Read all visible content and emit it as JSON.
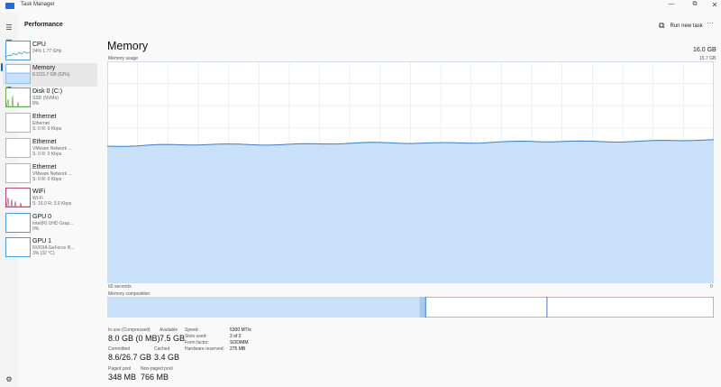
{
  "app": {
    "title": "Task Manager"
  },
  "window_controls": {
    "minimize": "—",
    "maximize": "⧉",
    "close": "✕"
  },
  "header": {
    "page_title": "Performance",
    "run_new_task": "Run new task",
    "more": "···"
  },
  "sidebar": [
    {
      "name": "CPU",
      "sub1": "24% 1.77 GHz",
      "sub2": "",
      "icon": "cpu-thumbnail",
      "color": "#4e9ad6"
    },
    {
      "name": "Memory",
      "sub1": "8.2/15.7 GB (52%)",
      "sub2": "",
      "icon": "memory-thumbnail",
      "color": "#8fbce8"
    },
    {
      "name": "Disk 0 (C:)",
      "sub1": "SSD (NVMe)",
      "sub2": "8%",
      "icon": "disk-thumbnail",
      "color": "#6aa84f"
    },
    {
      "name": "Ethernet",
      "sub1": "Ethernet",
      "sub2": "S: 0 R: 0 Kbps",
      "icon": "ethernet-thumbnail",
      "color": "#b5b5b5"
    },
    {
      "name": "Ethernet",
      "sub1": "VMware Network ...",
      "sub2": "S: 0 R: 0 Kbps",
      "icon": "ethernet-thumbnail",
      "color": "#b5b5b5"
    },
    {
      "name": "Ethernet",
      "sub1": "VMware Network ...",
      "sub2": "S: 0 R: 0 Kbps",
      "icon": "ethernet-thumbnail",
      "color": "#b5b5b5"
    },
    {
      "name": "WiFi",
      "sub1": "Wi-Fi",
      "sub2": "S: 16.0 R: 3.0 Kbps",
      "icon": "wifi-thumbnail",
      "color": "#b04a7c"
    },
    {
      "name": "GPU 0",
      "sub1": "Intel(R) UHD Grap...",
      "sub2": "0%",
      "icon": "gpu-thumbnail",
      "color": "#4e9ad6"
    },
    {
      "name": "GPU 1",
      "sub1": "NVIDIA GeForce R...",
      "sub2": "3% (32 °C)",
      "icon": "gpu-thumbnail",
      "color": "#4e9ad6"
    }
  ],
  "detail": {
    "title": "Memory",
    "total": "16.0 GB",
    "usage_label": "Memory usage",
    "max_label": "15.7 GB",
    "axis_left": "60 seconds",
    "axis_right": "0",
    "composition_label": "Memory composition",
    "usage_level": 0.62,
    "composition": {
      "in_use": 0.515,
      "modified": 0.01,
      "standby": 0.2,
      "free": 0.275
    }
  },
  "stats": {
    "in_use": {
      "label": "In use (Compressed)",
      "value": "8.0 GB (0 MB)"
    },
    "available": {
      "label": "Available",
      "value": "7.5 GB"
    },
    "committed": {
      "label": "Committed",
      "value": "8.6/26.7 GB"
    },
    "cached": {
      "label": "Cached",
      "value": "3.4 GB"
    },
    "paged_pool": {
      "label": "Paged pool",
      "value": "348 MB"
    },
    "non_paged_pool": {
      "label": "Non-paged pool",
      "value": "766 MB"
    }
  },
  "hardware": [
    {
      "label": "Speed:",
      "value": "5300 MT/s"
    },
    {
      "label": "Slots used:",
      "value": "2 of 2"
    },
    {
      "label": "Form factor:",
      "value": "SODIMM"
    },
    {
      "label": "Hardware reserved:",
      "value": "275 MB"
    }
  ],
  "colors": {
    "accent": "#0a64c8",
    "memory_fill": "#c9e0f9",
    "memory_line": "#3c7ebf",
    "grid": "#dfe8f2"
  }
}
